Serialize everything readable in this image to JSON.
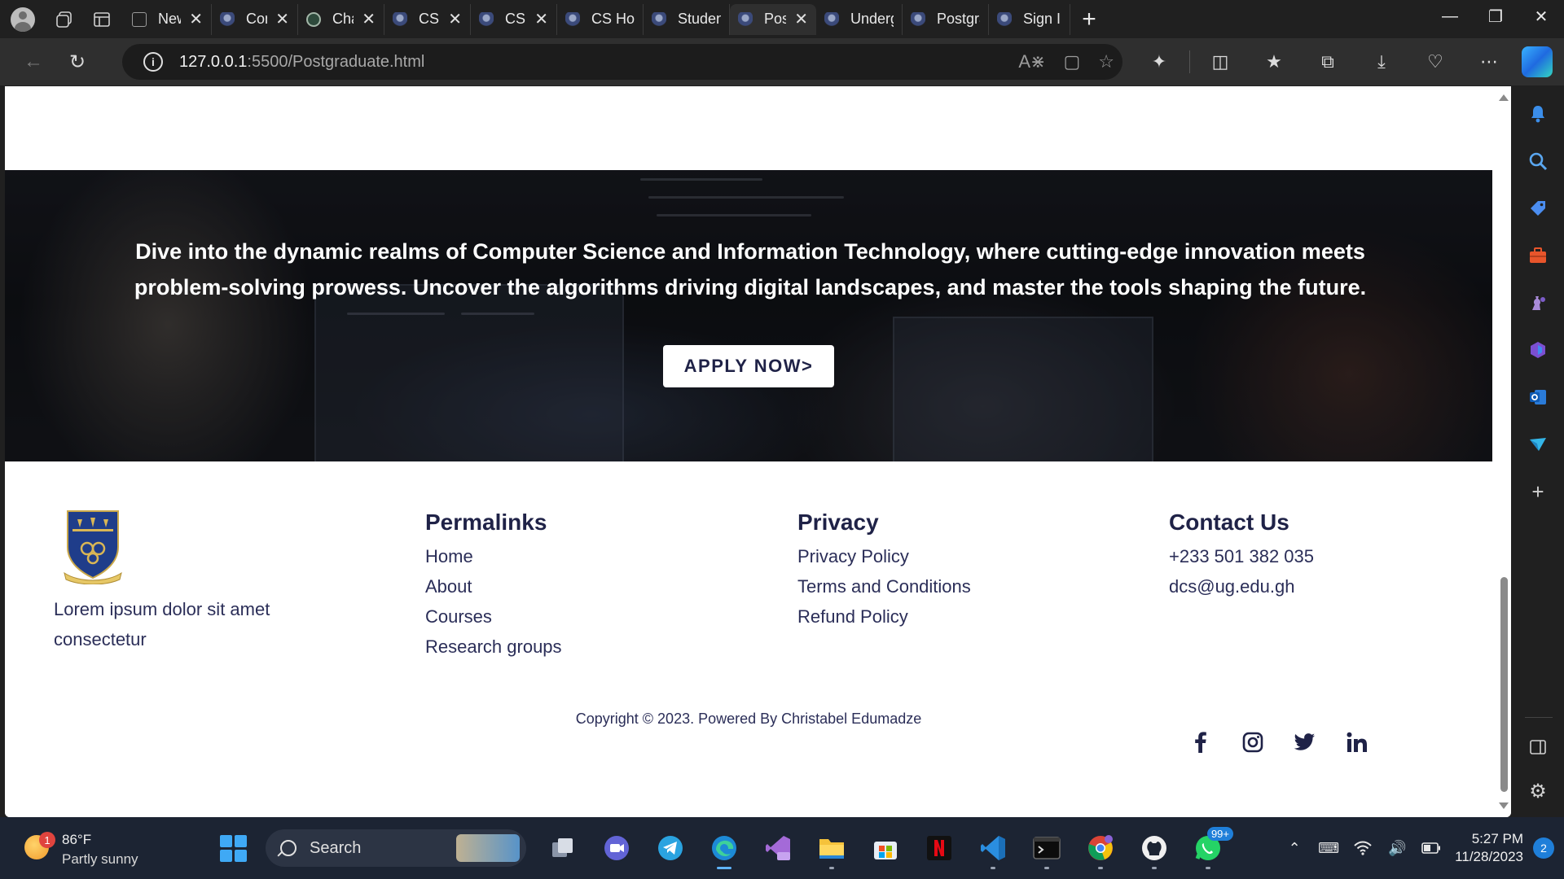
{
  "browser": {
    "tabs": [
      {
        "title": "New",
        "icon": "blank-page-icon",
        "closable": true,
        "active": false
      },
      {
        "title": "Con",
        "icon": "ug-crest-icon",
        "closable": true,
        "active": false
      },
      {
        "title": "Cha",
        "icon": "chatgpt-icon",
        "closable": true,
        "active": false
      },
      {
        "title": "CS I",
        "icon": "ug-crest-icon",
        "closable": true,
        "active": false
      },
      {
        "title": "CS I",
        "icon": "ug-crest-icon",
        "closable": true,
        "active": false
      },
      {
        "title": "CS Home",
        "icon": "ug-crest-icon",
        "closable": false,
        "active": false
      },
      {
        "title": "Students",
        "icon": "ug-crest-icon",
        "closable": false,
        "active": false
      },
      {
        "title": "Post",
        "icon": "ug-crest-icon",
        "closable": true,
        "active": true
      },
      {
        "title": "Undergra",
        "icon": "ug-crest-icon",
        "closable": false,
        "active": false
      },
      {
        "title": "Postgrad",
        "icon": "ug-crest-icon",
        "closable": false,
        "active": false
      },
      {
        "title": "Sign In",
        "icon": "ug-crest-icon",
        "closable": false,
        "active": false
      }
    ],
    "url_host": "127.0.0.1",
    "url_path": ":5500/Postgraduate.html"
  },
  "hero": {
    "text": "Dive into the dynamic realms of Computer Science and Information Technology, where cutting-edge innovation meets problem-solving prowess. Uncover the algorithms driving digital landscapes, and master the tools shaping the future.",
    "button_label": "APPLY NOW>"
  },
  "footer": {
    "about_text": "Lorem ipsum dolor sit amet consectetur",
    "permalinks": {
      "heading": "Permalinks",
      "links": [
        "Home",
        "About",
        "Courses",
        "Research groups"
      ]
    },
    "privacy": {
      "heading": "Privacy",
      "links": [
        "Privacy Policy",
        "Terms and Conditions",
        "Refund Policy"
      ]
    },
    "contact": {
      "heading": "Contact Us",
      "phone": "+233 501 382 035",
      "email": "dcs@ug.edu.gh"
    },
    "socials": [
      "facebook-icon",
      "instagram-icon",
      "twitter-icon",
      "linkedin-icon"
    ],
    "copyright": "Copyright © 2023. Powered By Christabel Edumadze",
    "text_color": "#23264f"
  },
  "taskbar": {
    "weather_temp": "86°F",
    "weather_condition": "Partly sunny",
    "weather_badge": "1",
    "search_label": "Search",
    "whatsapp_badge": "99+",
    "time": "5:27 PM",
    "date": "11/28/2023",
    "notification_count": "2"
  },
  "colors": {
    "brand_navy": "#1f2247",
    "browser_dark": "#202020",
    "taskbar": "#1c2433"
  }
}
